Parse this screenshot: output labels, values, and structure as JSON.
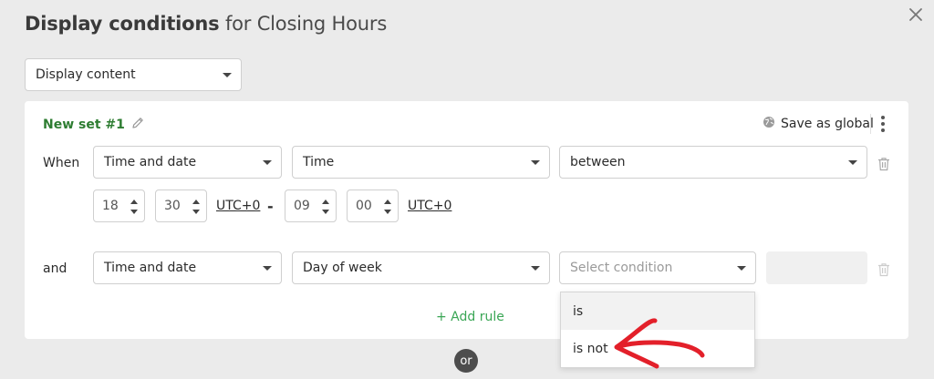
{
  "dialog": {
    "title_bold": "Display conditions",
    "title_rest": " for Closing Hours"
  },
  "display_select": {
    "value": "Display content"
  },
  "set": {
    "name": "New set #1",
    "save_global_label": "Save as global"
  },
  "rule1": {
    "prefix": "When",
    "category": "Time and date",
    "type": "Time",
    "operator": "between",
    "from_hour": "18",
    "from_minute": "30",
    "from_tz": "UTC+0",
    "separator": "-",
    "to_hour": "09",
    "to_minute": "00",
    "to_tz": "UTC+0"
  },
  "rule2": {
    "prefix": "and",
    "category": "Time and date",
    "type": "Day of week",
    "condition_placeholder": "Select condition"
  },
  "add_rule": "+ Add rule",
  "or_label": "or",
  "condition_options": [
    "is",
    "is not"
  ],
  "colors": {
    "accent_green": "#2e7d32",
    "add_rule_green": "#3aa655",
    "annotation_red": "#e3202a"
  }
}
